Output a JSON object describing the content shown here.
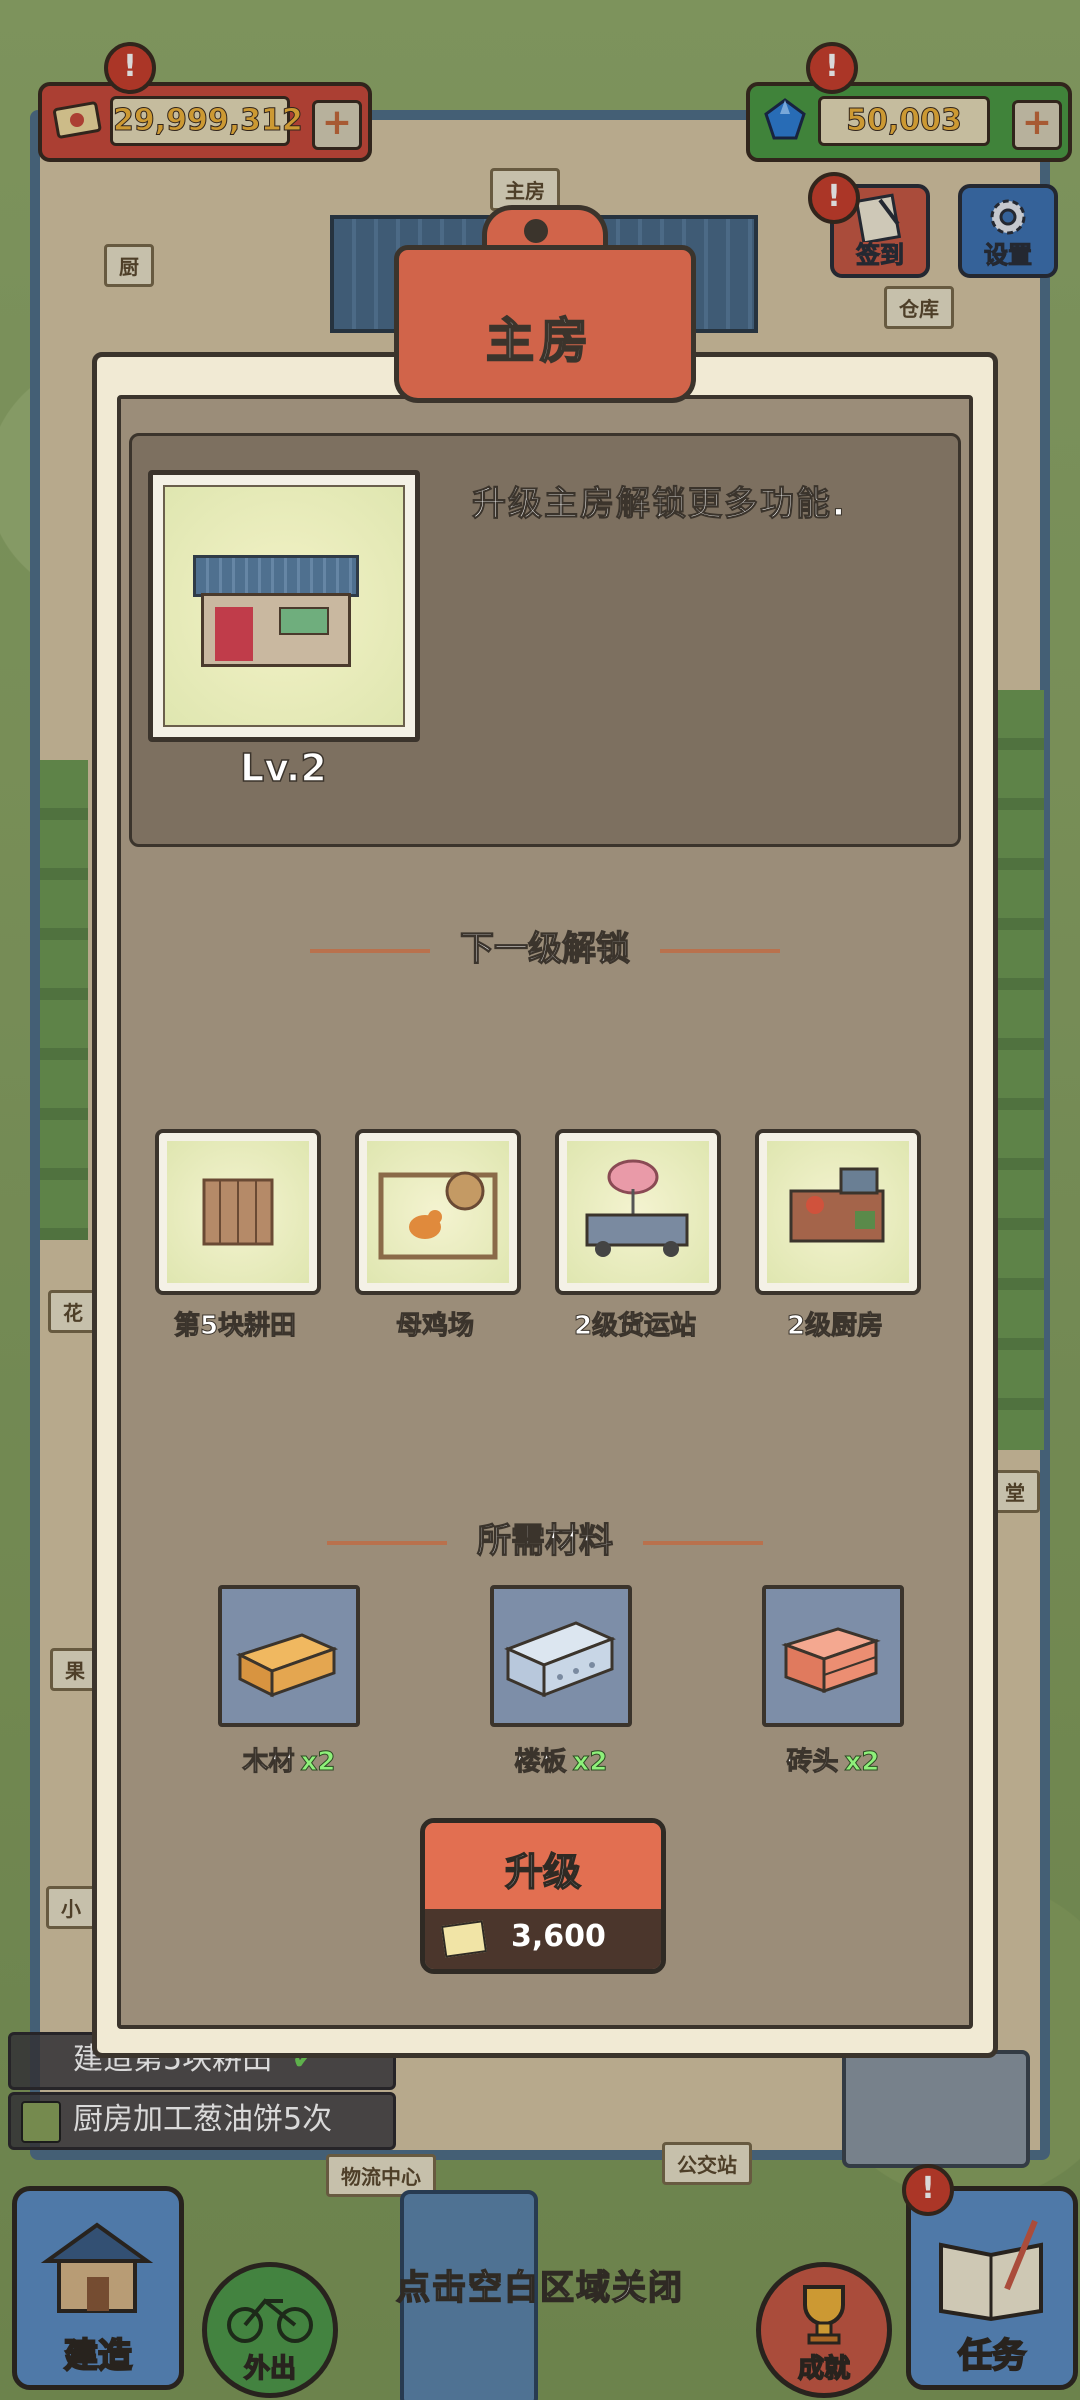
{
  "hud": {
    "cash": "29,999,312",
    "gems": "50,003",
    "plus": "+",
    "alert": "!",
    "checkin": "签到",
    "settings": "设置"
  },
  "map_signs": {
    "main_house": "主房",
    "kitchen": "厨",
    "warehouse": "仓库",
    "flower": "花",
    "orchard": "果",
    "small": "小",
    "hall": "堂",
    "logistics": "物流中心",
    "bus_stop": "公交站"
  },
  "tasks": [
    {
      "text": "建造第5块耕田",
      "done": true
    },
    {
      "text": "厨房加工葱油饼5次"
    }
  ],
  "panel": {
    "title": "主房",
    "description": "升级主房解锁更多功能.",
    "level": "Lv.2",
    "unlock_heading": "下一级解锁",
    "unlocks": [
      {
        "name": "第5块耕田",
        "icon": "farmland-icon"
      },
      {
        "name": "母鸡场",
        "icon": "hen-yard-icon"
      },
      {
        "name": "2级货运站",
        "icon": "freight-station-icon"
      },
      {
        "name": "2级厨房",
        "icon": "kitchen-icon"
      }
    ],
    "materials_heading": "所需材料",
    "materials": [
      {
        "name": "木材",
        "qty": "x2",
        "icon": "wood-icon"
      },
      {
        "name": "楼板",
        "qty": "x2",
        "icon": "floor-slab-icon"
      },
      {
        "name": "砖头",
        "qty": "x2",
        "icon": "brick-icon"
      }
    ],
    "upgrade_label": "升级",
    "upgrade_cost": "3,600"
  },
  "bottom_nav": {
    "build": "建造",
    "go_out": "外出",
    "achievements": "成就",
    "missions": "任务"
  },
  "close_hint": "点击空白区域关闭",
  "colors": {
    "panel_bg": "#9b8d79",
    "title_tag": "#d1644a",
    "upgrade_button": "#e26f51",
    "quantity_green": "#8ef07a"
  }
}
